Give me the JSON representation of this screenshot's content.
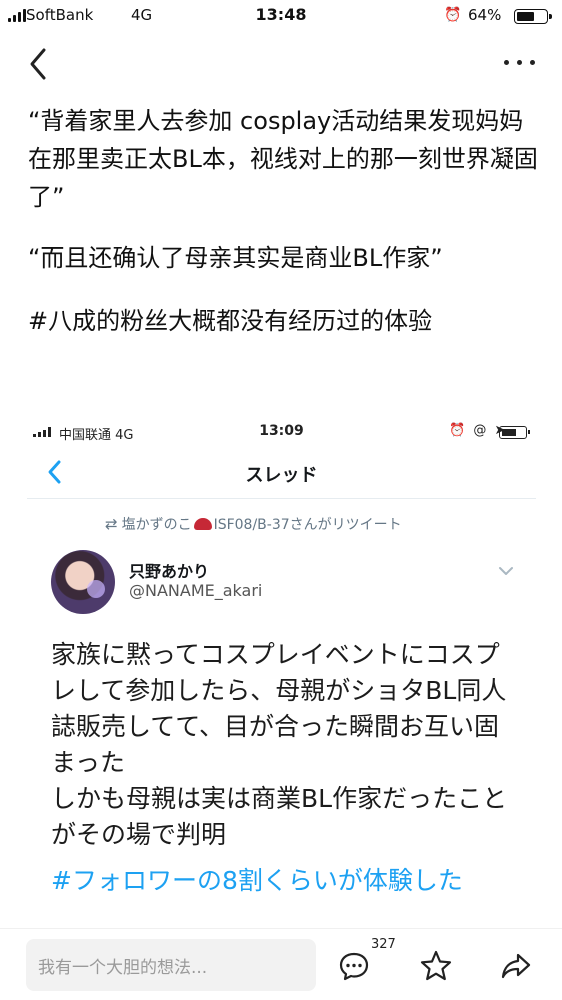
{
  "status_bar": {
    "carrier": "SoftBank",
    "network": "4G",
    "time": "13:48",
    "alarm_icon": "alarm-icon",
    "battery_percent": "64%",
    "battery_level": 0.64
  },
  "nav": {
    "back_icon": "chevron-left-icon",
    "more_icon": "more-dots-icon"
  },
  "post": {
    "paragraph1": "“背着家里人去参加 cosplay活动结果发现妈妈在那里卖正太BL本，视线对上的那一刻世界凝固了”",
    "paragraph2": "“而且还确认了母亲其实是商业BL作家”",
    "hashtag": "#八成的粉丝大概都没有经历过的体验"
  },
  "embedded_screenshot": {
    "status": {
      "carrier": "中国联通",
      "network": "4G",
      "time": "13:09",
      "icons": "⏰ @ ➤"
    },
    "nav_title": "スレッド",
    "retweet_line_pre": "塩かずのこ",
    "retweet_line_post": "ISF08/B-37さんがリツイート",
    "author_name": "只野あかり",
    "author_handle": "@NANAME_akari",
    "tweet_text_1": "家族に黙ってコスプレイベントにコスプレして参加したら、母親がショタBL同人誌販売してて、目が合った瞬間お互い固まった",
    "tweet_text_2": "しかも母親は実は商業BL作家だったことがその場で判明",
    "tweet_hashtag": "#フォロワーの8割くらいが体験した"
  },
  "bottom_bar": {
    "input_placeholder": "我有一个大胆的想法...",
    "comment_count": "327",
    "comment_icon": "comment-bubble-icon",
    "favorite_icon": "star-icon",
    "share_icon": "share-arrow-icon"
  }
}
